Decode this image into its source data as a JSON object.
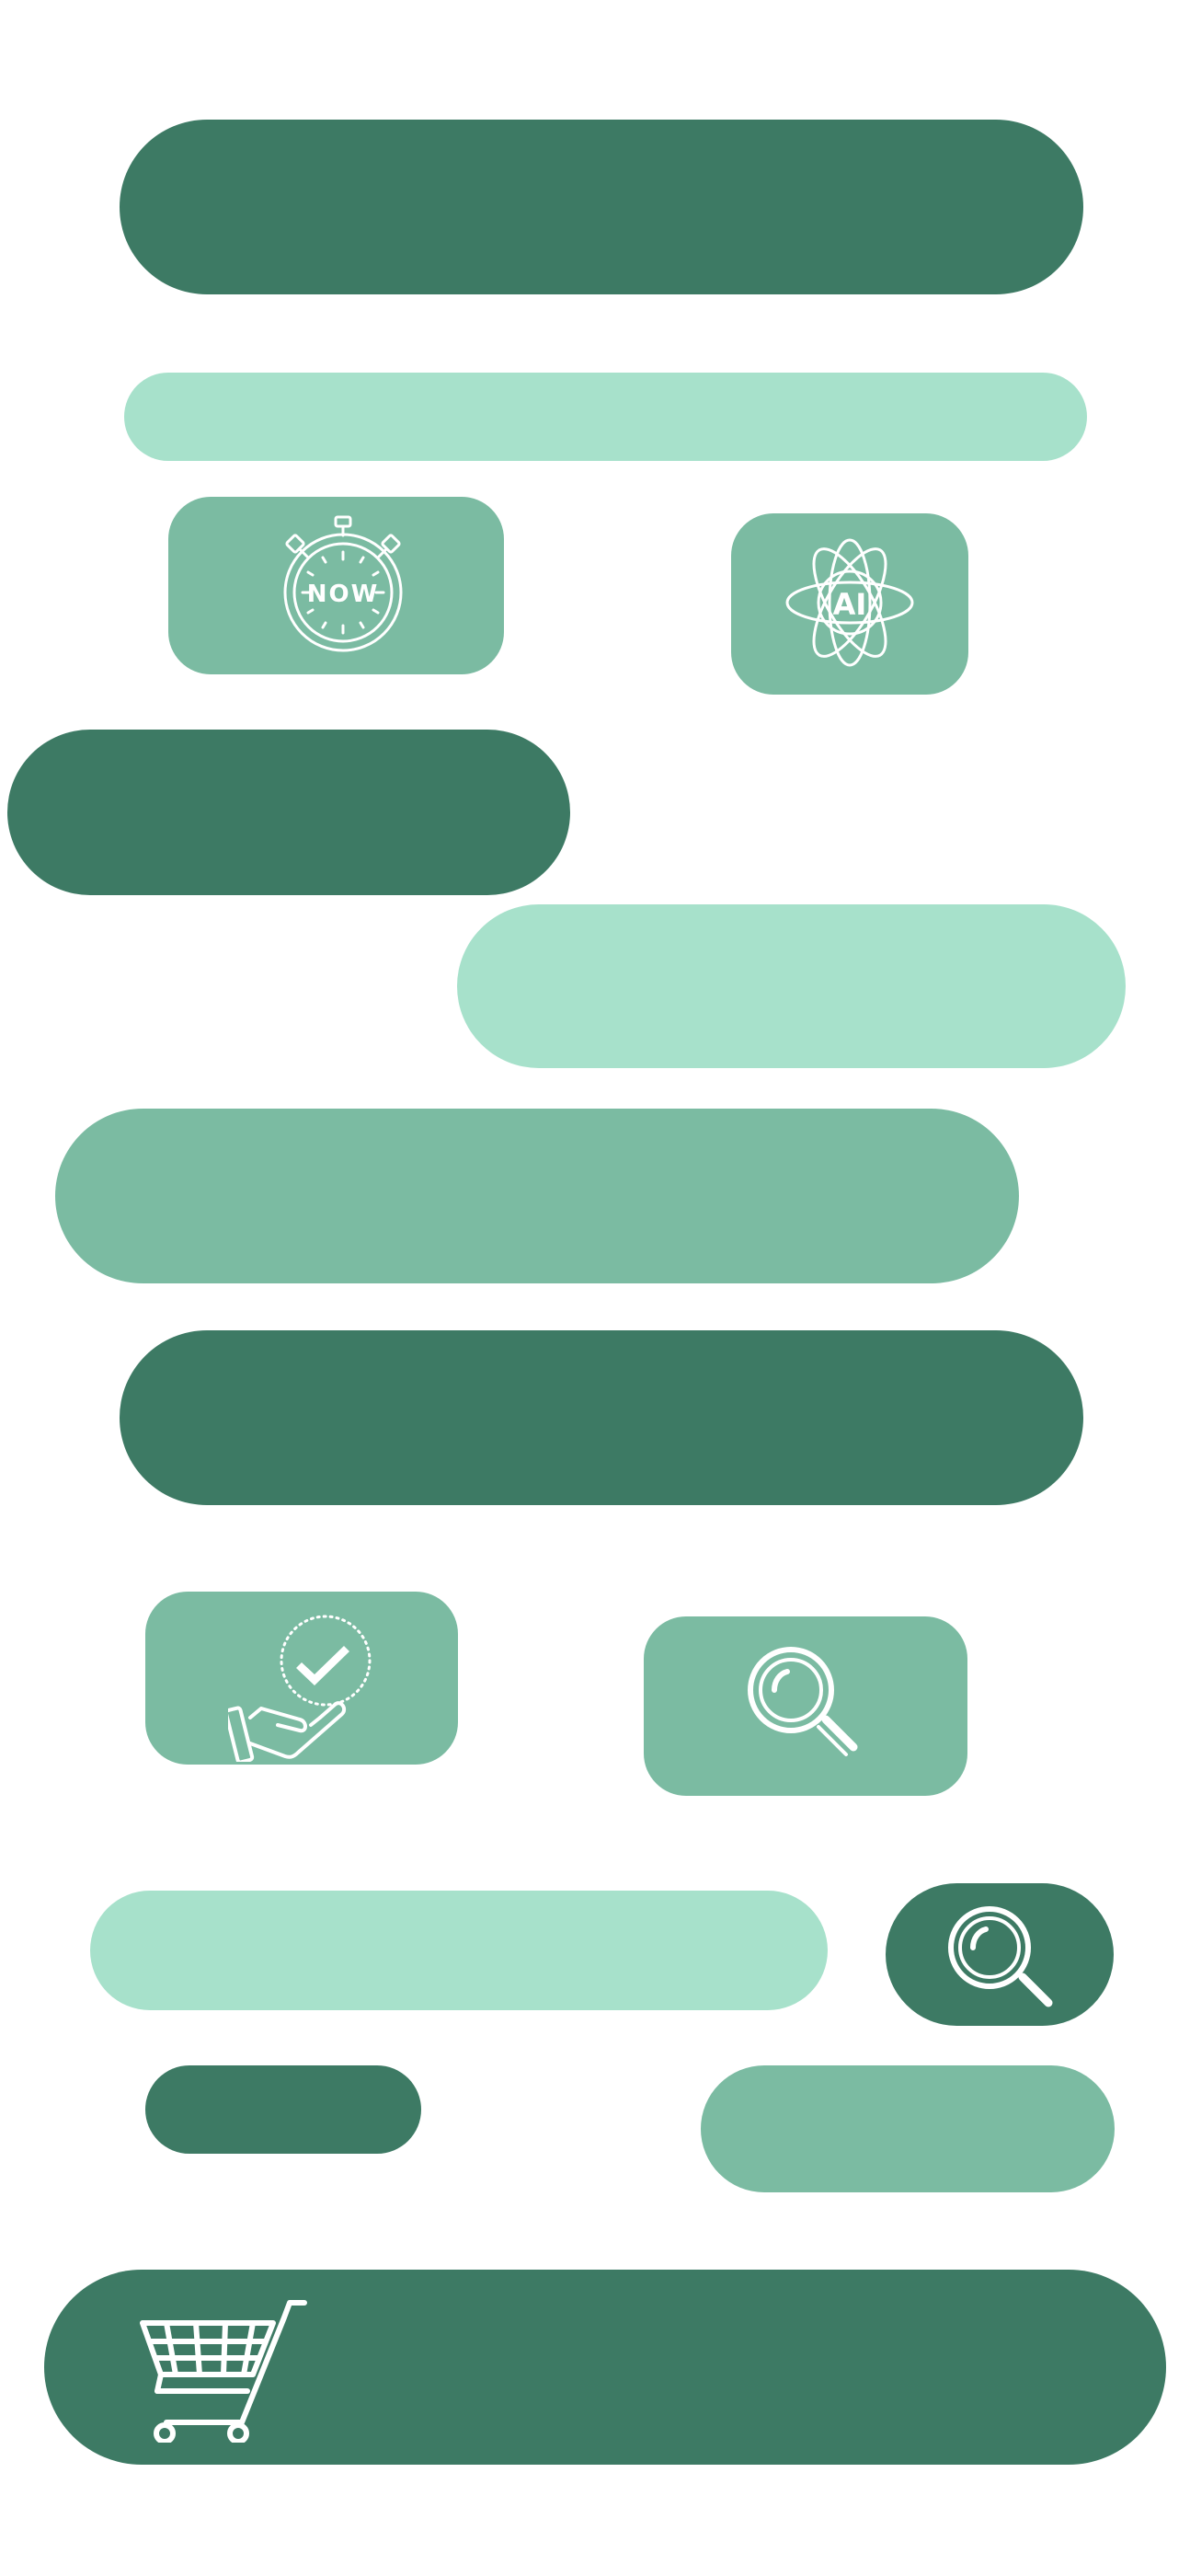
{
  "colors": {
    "dark_green": "#3d7a64",
    "mid_green": "#7bbba2",
    "light_green": "#a7e1cb",
    "icon_stroke": "#ffffff",
    "background": "#ffffff"
  },
  "icons": {
    "stopwatch": {
      "name": "stopwatch-now-icon",
      "label": "NOW"
    },
    "atom": {
      "name": "atom-ai-icon",
      "label": "AI"
    },
    "hand_check": {
      "name": "hand-checkmark-icon"
    },
    "search_box": {
      "name": "search-icon"
    },
    "search_pill": {
      "name": "search-icon"
    },
    "cart": {
      "name": "shopping-cart-icon"
    }
  }
}
